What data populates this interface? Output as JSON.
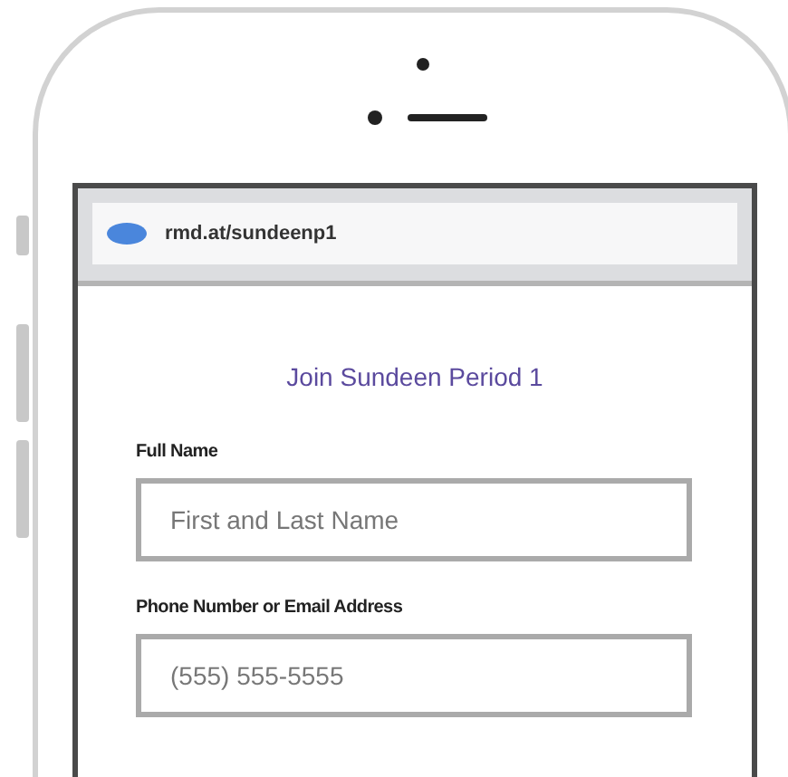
{
  "browser": {
    "url": "rmd.at/sundeenp1"
  },
  "form": {
    "title": "Join Sundeen Period 1",
    "fields": [
      {
        "label": "Full Name",
        "placeholder": "First and Last Name"
      },
      {
        "label": "Phone Number or Email Address",
        "placeholder": "(555) 555-5555"
      }
    ]
  }
}
